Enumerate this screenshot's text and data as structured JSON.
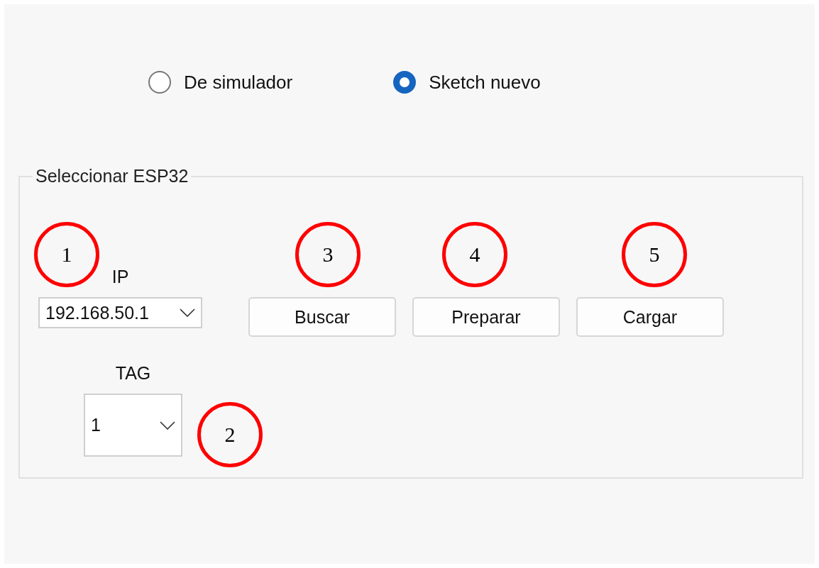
{
  "radios": [
    {
      "label": "De simulador",
      "selected": false
    },
    {
      "label": "Sketch nuevo",
      "selected": true
    }
  ],
  "group": {
    "title": "Seleccionar ESP32",
    "ip": {
      "label": "IP",
      "value": "192.168.50.1"
    },
    "buttons": [
      "Buscar",
      "Preparar",
      "Cargar"
    ],
    "tag": {
      "label": "TAG",
      "value": "1"
    }
  },
  "annotations": [
    {
      "label": "1"
    },
    {
      "label": "3"
    },
    {
      "label": "4"
    },
    {
      "label": "5"
    },
    {
      "label": "2"
    }
  ]
}
